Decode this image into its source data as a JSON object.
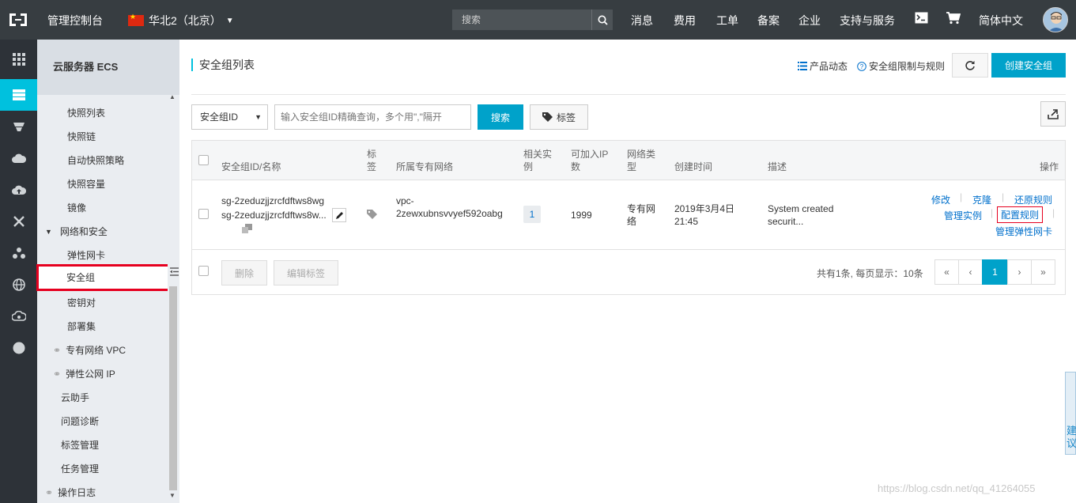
{
  "topbar": {
    "console_label": "管理控制台",
    "region_label": "华北2（北京）",
    "search_placeholder": "搜索",
    "nav": [
      "消息",
      "费用",
      "工单",
      "备案",
      "企业",
      "支持与服务"
    ],
    "language": "简体中文"
  },
  "sidebar": {
    "title": "云服务器 ECS",
    "items": {
      "snapshot_list": "快照列表",
      "snapshot_chain": "快照链",
      "auto_snapshot_policy": "自动快照策略",
      "snapshot_capacity": "快照容量",
      "image": "镜像",
      "network_security": "网络和安全",
      "eni": "弹性网卡",
      "security_group": "安全组",
      "key_pair": "密钥对",
      "deployment_set": "部署集",
      "vpc": "专有网络 VPC",
      "eip": "弹性公网 IP",
      "cloud_assistant": "云助手",
      "diagnosis": "问题诊断",
      "tag_management": "标签管理",
      "task_management": "任务管理",
      "operation_log": "操作日志"
    }
  },
  "main": {
    "page_title": "安全组列表",
    "product_news": "产品动态",
    "limits_rules": "安全组限制与规则",
    "create_button": "创建安全组",
    "filter": {
      "select_value": "安全组ID",
      "input_placeholder": "输入安全组ID精确查询，多个用\",\"隔开",
      "search_button": "搜索",
      "tag_button": "标签"
    },
    "table": {
      "headers": {
        "id_name": "安全组ID/名称",
        "tag_1": "标",
        "tag_2": "签",
        "vpc": "所属专有网络",
        "related_1": "相关实",
        "related_2": "例",
        "ip_1": "可加入IP",
        "ip_2": "数",
        "nettype_1": "网络类",
        "nettype_2": "型",
        "created": "创建时间",
        "desc": "描述",
        "ops": "操作"
      },
      "rows": [
        {
          "id": "sg-2zeduzjjzrcfdftws8wg",
          "name": "sg-2zeduzjjzrcfdftws8w...",
          "vpc_1": "vpc-",
          "vpc_2": "2zewxubnsvvyef592oabg",
          "related": "1",
          "ip_count": "1999",
          "nettype_1": "专有网",
          "nettype_2": "络",
          "created_1": "2019年3月4日",
          "created_2": "21:45",
          "desc_1": "System created",
          "desc_2": "securit...",
          "ops": {
            "modify": "修改",
            "clone": "克隆",
            "restore": "还原规则",
            "manage_instance": "管理实例",
            "config_rules": "配置规则",
            "manage_eni": "管理弹性网卡"
          }
        }
      ],
      "footer": {
        "delete": "删除",
        "edit_tags": "编辑标签",
        "summary": "共有1条, 每页显示：10条",
        "pages": [
          "«",
          "‹",
          "1",
          "›",
          "»"
        ]
      }
    }
  },
  "float_tab": "建议",
  "watermark": "https://blog.csdn.net/qq_41264055",
  "colors": {
    "topbar_bg": "#373d41",
    "accent": "#00a2ca",
    "active_rail": "#00c1de",
    "link": "#0070cc",
    "highlight_box": "#e6001f"
  }
}
